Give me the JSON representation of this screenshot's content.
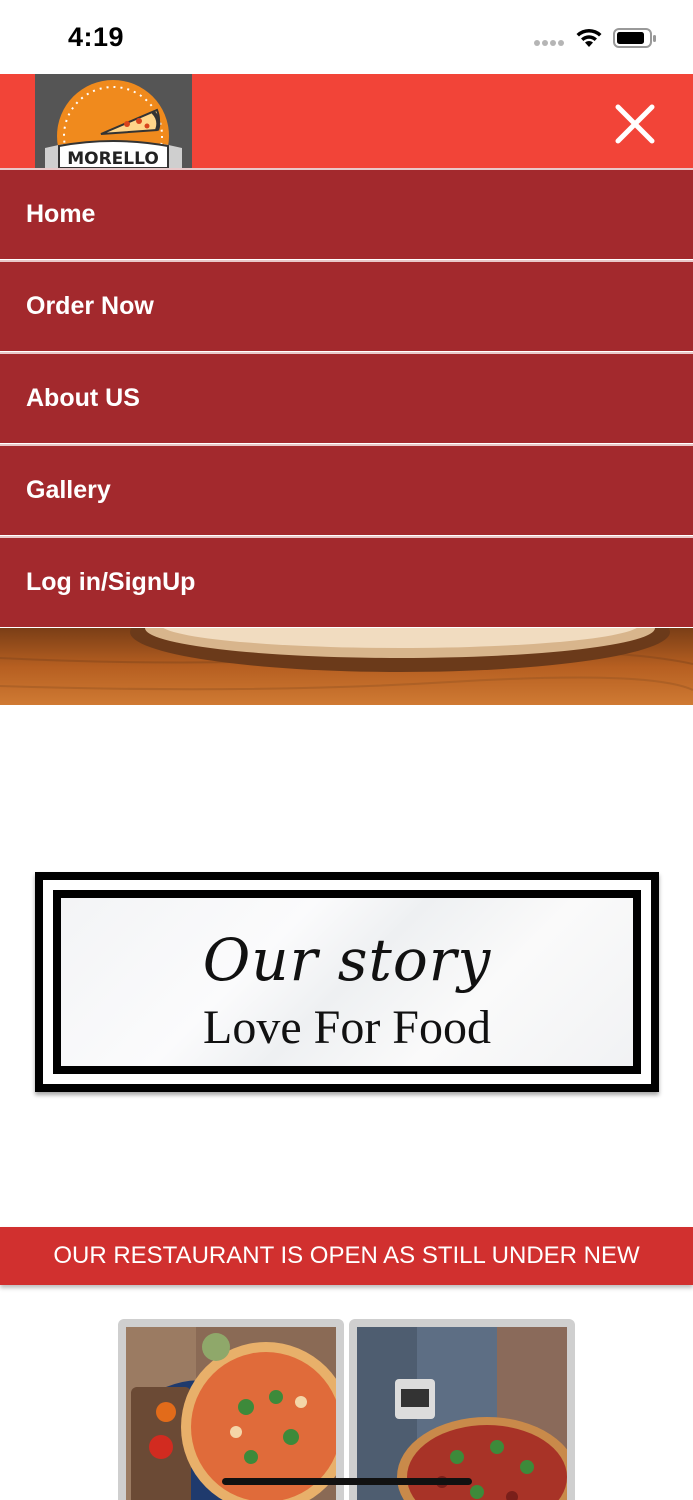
{
  "status_bar": {
    "time": "4:19",
    "icons": [
      "signal-icon",
      "wifi-icon",
      "battery-icon"
    ]
  },
  "header": {
    "logo_text": "MORELLO",
    "icons": [
      "logo",
      "close-icon"
    ]
  },
  "nav": {
    "items": [
      {
        "label": "Home"
      },
      {
        "label": "Order Now"
      },
      {
        "label": "About US"
      },
      {
        "label": "Gallery"
      },
      {
        "label": "Log in/SignUp"
      }
    ]
  },
  "story": {
    "title": "Our story",
    "subtitle": "Love For Food"
  },
  "banner": {
    "text": "OUR RESTAURANT IS OPEN AS STILL UNDER NEW"
  },
  "colors": {
    "header_red": "#f24438",
    "menu_red": "#a3292d",
    "banner_red": "#d1302f",
    "logo_orange": "#f08a1d"
  }
}
